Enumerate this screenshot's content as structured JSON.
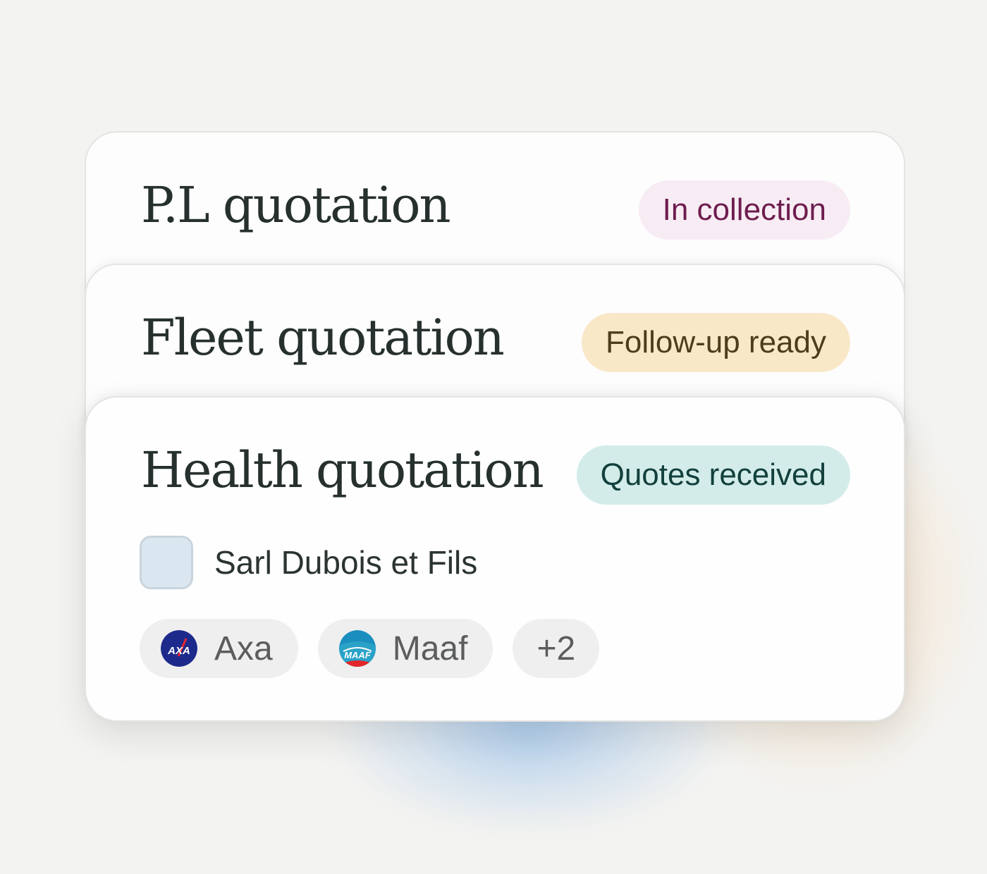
{
  "cards": [
    {
      "title": "P.L quotation",
      "status": "In collection",
      "status_color": "#f8ecf4",
      "status_text_color": "#6d1d4e"
    },
    {
      "title": "Fleet quotation",
      "status": "Follow-up ready",
      "status_color": "#f9e8c8",
      "status_text_color": "#4f3c1c"
    },
    {
      "title": "Health quotation",
      "status": "Quotes received",
      "status_color": "#d3ecea",
      "status_text_color": "#12403d",
      "company": {
        "name": "Sarl Dubois et Fils",
        "logo_icon": "company-placeholder-icon"
      },
      "insurers": [
        {
          "name": "Axa",
          "logo_text": "AXA",
          "logo_icon": "axa-logo-icon",
          "brand_color": "#1d2a8c"
        },
        {
          "name": "Maaf",
          "logo_text": "MAAF",
          "logo_icon": "maaf-logo-icon",
          "brand_color": "#1a8fbf"
        }
      ],
      "more_insurers": "+2"
    }
  ]
}
